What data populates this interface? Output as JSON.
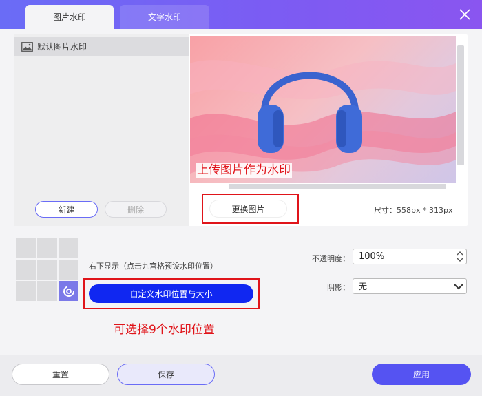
{
  "tabs": [
    {
      "label": "图片水印",
      "active": true
    },
    {
      "label": "文字水印",
      "active": false
    }
  ],
  "watermark_list": {
    "items": [
      {
        "label": "默认图片水印",
        "icon": "image-icon"
      }
    ],
    "new_label": "新建",
    "delete_label": "删除"
  },
  "preview": {
    "annotation": "上传图片作为水印",
    "change_label": "更换图片",
    "size_text": "尺寸：558px * 313px"
  },
  "position": {
    "description": "右下显示（点击九宫格预设水印位置）",
    "custom_label": "自定义水印位置与大小",
    "annotation": "可选择9个水印位置",
    "selected_cell": 8
  },
  "opacity": {
    "label": "不透明度：",
    "value": "100%"
  },
  "shadow": {
    "label": "阴影：",
    "value": "无"
  },
  "footer": {
    "reset_label": "重置",
    "save_label": "保存",
    "apply_label": "应用"
  },
  "colors": {
    "accent": "#5553f2",
    "primary_button": "#1027f1",
    "annotation_red": "#e0141a"
  }
}
